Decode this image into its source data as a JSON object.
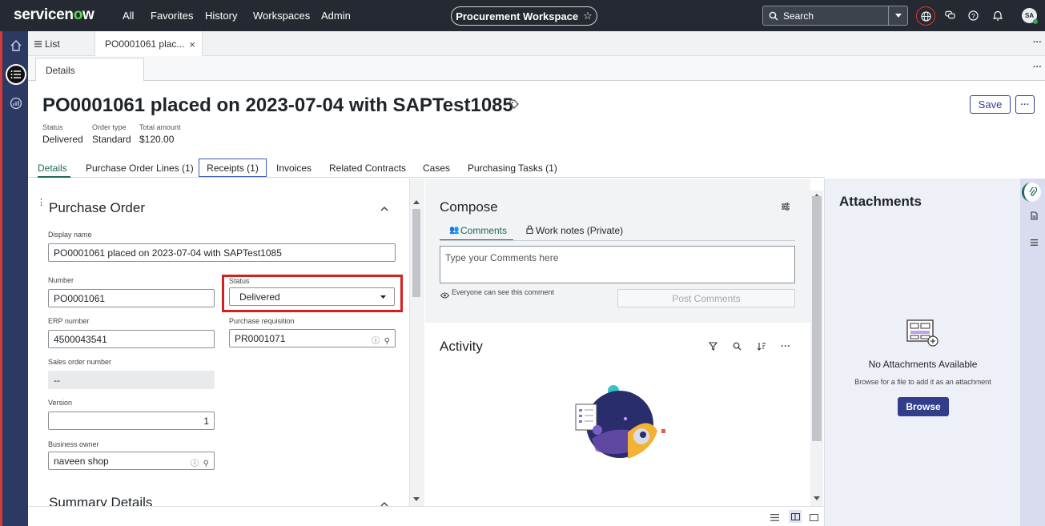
{
  "topbar": {
    "logo_prefix": "servicen",
    "logo_o": "o",
    "logo_suffix": "w",
    "nav": [
      "All",
      "Favorites",
      "History",
      "Workspaces",
      "Admin"
    ],
    "workspace_label": "Procurement Workspace",
    "search_label": "Search",
    "avatar_initials": "SA"
  },
  "tabs": {
    "list_label": "List",
    "record_label": "PO0001061 plac..."
  },
  "subtab": {
    "details_label": "Details"
  },
  "record": {
    "title": "PO0001061 placed on 2023-07-04 with SAPTest1085",
    "save_label": "Save",
    "summary": [
      {
        "label": "Status",
        "value": "Delivered"
      },
      {
        "label": "Order type",
        "value": "Standard"
      },
      {
        "label": "Total amount",
        "value": "$120.00"
      }
    ]
  },
  "related_tabs": [
    "Details",
    "Purchase Order Lines (1)",
    "Receipts (1)",
    "Invoices",
    "Related Contracts",
    "Cases",
    "Purchasing Tasks (1)"
  ],
  "form": {
    "section_title": "Purchase Order",
    "display_name_label": "Display name",
    "display_name_value": "PO0001061 placed on 2023-07-04 with SAPTest1085",
    "number_label": "Number",
    "number_value": "PO0001061",
    "status_label": "Status",
    "status_value": "Delivered",
    "erp_label": "ERP number",
    "erp_value": "4500043541",
    "requisition_label": "Purchase requisition",
    "requisition_value": "PR0001071",
    "sales_order_label": "Sales order number",
    "sales_order_value": "--",
    "version_label": "Version",
    "version_value": "1",
    "owner_label": "Business owner",
    "owner_value": "naveen shop",
    "next_section_title": "Summary Details"
  },
  "compose": {
    "title": "Compose",
    "tab_comments": "Comments",
    "tab_work_notes": "Work notes (Private)",
    "placeholder": "Type your Comments here",
    "note": "Everyone can see this comment",
    "post_label": "Post Comments"
  },
  "activity": {
    "title": "Activity"
  },
  "attachments": {
    "title": "Attachments",
    "empty_title": "No Attachments Available",
    "empty_hint": "Browse for a file to add it as an attachment",
    "browse_label": "Browse"
  },
  "colors": {
    "accent": "#1b6a5a",
    "brand_button": "#323e8c",
    "highlight": "#d42020",
    "rail": "#2c3a63"
  }
}
